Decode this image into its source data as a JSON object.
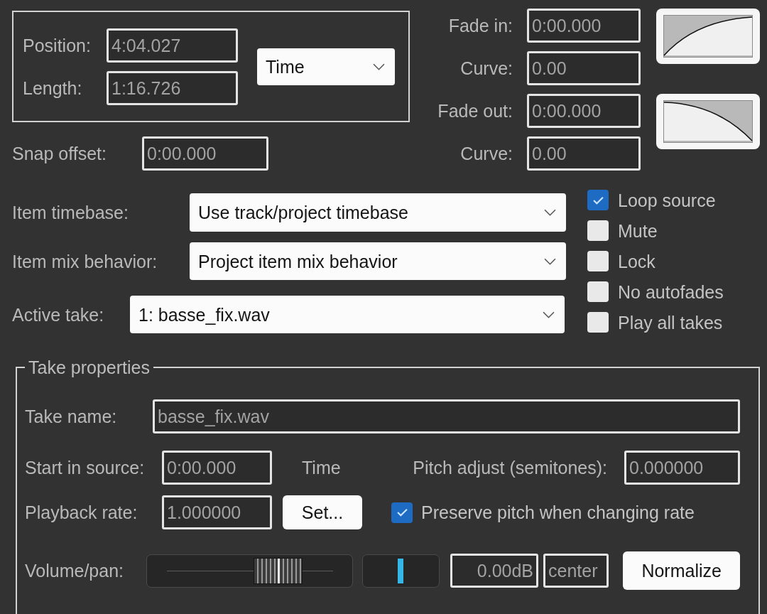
{
  "position_group": {
    "position": {
      "label": "Position:",
      "value": "4:04.027"
    },
    "length": {
      "label": "Length:",
      "value": "1:16.726"
    },
    "time_format": {
      "value": "Time"
    }
  },
  "snap_offset": {
    "label": "Snap offset:",
    "value": "0:00.000"
  },
  "fades": [
    {
      "kind": "in",
      "label": "Fade in:",
      "value": "0:00.000",
      "curve_label": "Curve:",
      "curve_value": "0.00"
    },
    {
      "kind": "out",
      "label": "Fade out:",
      "value": "0:00.000",
      "curve_label": "Curve:",
      "curve_value": "0.00"
    }
  ],
  "item_settings": [
    {
      "label": "Item timebase:",
      "value": "Use track/project timebase"
    },
    {
      "label": "Item mix behavior:",
      "value": "Project item mix behavior"
    }
  ],
  "active_take": {
    "label": "Active take:",
    "value": "1: basse_fix.wav"
  },
  "item_flags": [
    {
      "label": "Loop source",
      "checked": true
    },
    {
      "label": "Mute",
      "checked": false
    },
    {
      "label": "Lock",
      "checked": false
    },
    {
      "label": "No autofades",
      "checked": false
    },
    {
      "label": "Play all takes",
      "checked": false
    }
  ],
  "take_properties": {
    "title": "Take properties",
    "take_name": {
      "label": "Take name:",
      "value": "basse_fix.wav"
    },
    "start_in_source": {
      "label": "Start in source:",
      "value": "0:00.000",
      "unit": "Time"
    },
    "pitch_adjust": {
      "label": "Pitch adjust (semitones):",
      "value": "0.000000"
    },
    "playback_rate": {
      "label": "Playback rate:",
      "value": "1.000000"
    },
    "set_button": "Set...",
    "preserve_pitch": {
      "label": "Preserve pitch when changing rate",
      "checked": true
    },
    "volume_pan": {
      "label": "Volume/pan:",
      "volume": {
        "level": 0.68
      },
      "pan": {
        "level": 0.5
      },
      "volume_reading": "0.00dB",
      "pan_reading": "center"
    },
    "normalize_button": "Normalize"
  }
}
